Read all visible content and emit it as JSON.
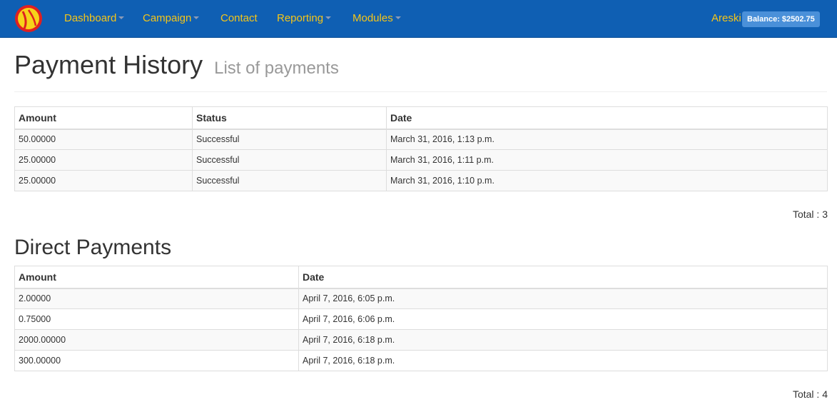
{
  "navbar": {
    "items": [
      {
        "label": "Dashboard",
        "has_caret": true
      },
      {
        "label": "Campaign",
        "has_caret": true
      },
      {
        "label": "Contact",
        "has_caret": false
      },
      {
        "label": "Reporting",
        "has_caret": true
      },
      {
        "label": "Modules",
        "has_caret": true
      }
    ],
    "user": "Areski",
    "balance": "Balance: $2502.75",
    "bg_color": "#0f5fb3",
    "link_color": "#f5c518",
    "logo_icon": "logo-icon"
  },
  "header": {
    "title": "Payment History",
    "subtitle": "List of payments"
  },
  "payment_history": {
    "columns": [
      "Amount",
      "Status",
      "Date"
    ],
    "rows": [
      {
        "amount": "50.00000",
        "status": "Successful",
        "date": "March 31, 2016, 1:13 p.m."
      },
      {
        "amount": "25.00000",
        "status": "Successful",
        "date": "March 31, 2016, 1:11 p.m."
      },
      {
        "amount": "25.00000",
        "status": "Successful",
        "date": "March 31, 2016, 1:10 p.m."
      }
    ],
    "total": "Total : 3"
  },
  "direct_payments": {
    "title": "Direct Payments",
    "columns": [
      "Amount",
      "Date"
    ],
    "rows": [
      {
        "amount": "2.00000",
        "date": "April 7, 2016, 6:05 p.m."
      },
      {
        "amount": "0.75000",
        "date": "April 7, 2016, 6:06 p.m."
      },
      {
        "amount": "2000.00000",
        "date": "April 7, 2016, 6:18 p.m."
      },
      {
        "amount": "300.00000",
        "date": "April 7, 2016, 6:18 p.m."
      }
    ],
    "total": "Total : 4"
  }
}
